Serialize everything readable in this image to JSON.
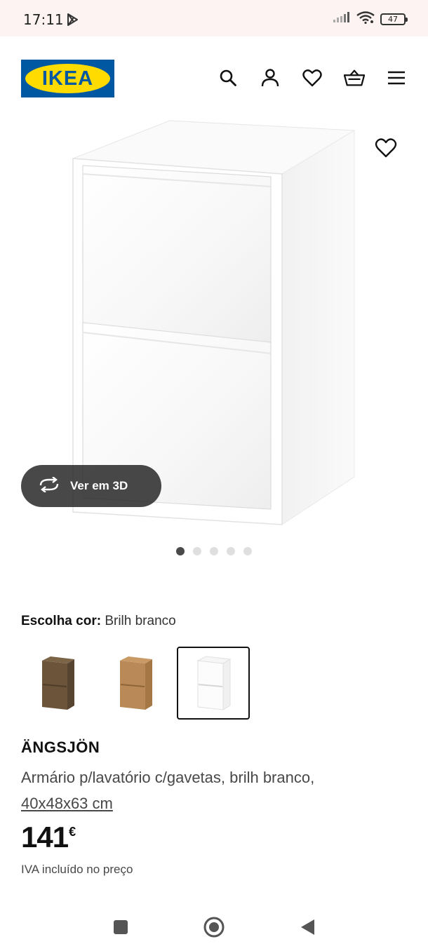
{
  "status": {
    "time": "17:11",
    "battery": "47"
  },
  "brand": {
    "logo_text": "IKEA",
    "blue": "#0058a3",
    "yellow": "#ffdb00"
  },
  "header": {
    "icons": [
      "search-icon",
      "account-icon",
      "heart-icon",
      "basket-icon",
      "menu-icon"
    ]
  },
  "gallery": {
    "view_3d_label": "Ver em 3D",
    "image_count": 5,
    "active_index": 0
  },
  "color_choice": {
    "label": "Escolha cor:",
    "selected": "Brilh branco",
    "swatches": [
      {
        "name": "walnut",
        "color": "#6b5439"
      },
      {
        "name": "oak",
        "color": "#b98a57"
      },
      {
        "name": "white",
        "color": "#ffffff",
        "selected": true
      }
    ]
  },
  "product": {
    "name": "ÄNGSJÖN",
    "description": "Armário p/lavatório c/gavetas, brilh branco,",
    "dimensions": "40x48x63 cm",
    "price": "141",
    "currency": "€",
    "vat_note": "IVA incluído no preço"
  }
}
